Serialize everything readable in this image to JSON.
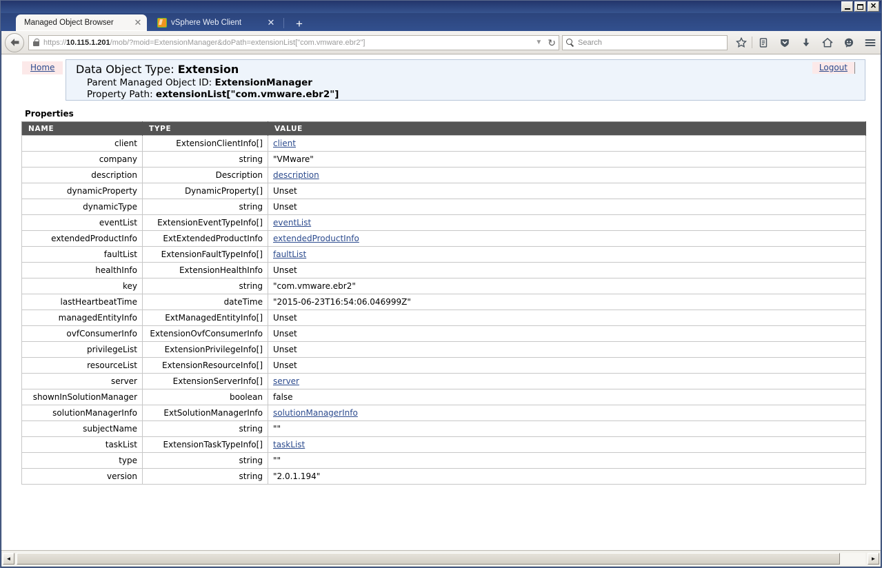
{
  "window": {
    "minimize_label": "Minimize",
    "maximize_label": "Maximize",
    "close_label": "Close"
  },
  "browser": {
    "tabs": [
      {
        "title": "Managed Object Browser",
        "active": true,
        "favicon": "none",
        "close_glyph": "✕"
      },
      {
        "title": "vSphere Web Client",
        "active": false,
        "favicon": "vsphere-plugin-icon",
        "close_glyph": "✕"
      }
    ],
    "new_tab_glyph": "+",
    "back_glyph": "←",
    "url": {
      "scheme": "https://",
      "host": "10.115.1.201",
      "path": "/mob/?moid=ExtensionManager&doPath=extensionList[\"com.vmware.ebr2\"]",
      "full": "https://10.115.1.201/mob/?moid=ExtensionManager&doPath=extensionList[\"com.vmware.ebr2\"]",
      "dropdown_glyph": "▼",
      "reload_glyph": "↻"
    },
    "search": {
      "placeholder": "Search",
      "value": ""
    },
    "toolbar_icons": [
      "bookmark-star-icon",
      "reader-list-icon",
      "pocket-shield-icon",
      "downloads-arrow-icon",
      "home-icon",
      "feedback-smiley-icon",
      "hamburger-menu-icon"
    ]
  },
  "page": {
    "home_link": "Home",
    "logout_link": "Logout",
    "title_prefix": "Data Object Type:",
    "title_value": "Extension",
    "parent_label": "Parent Managed Object ID:",
    "parent_value": "ExtensionManager",
    "path_label": "Property Path:",
    "path_value": "extensionList[\"com.vmware.ebr2\"]",
    "properties_heading": "Properties",
    "table": {
      "columns": [
        "NAME",
        "TYPE",
        "VALUE"
      ],
      "rows": [
        {
          "name": "client",
          "type": "ExtensionClientInfo[]",
          "value": "client",
          "is_link": true
        },
        {
          "name": "company",
          "type": "string",
          "value": "\"VMware\"",
          "is_link": false
        },
        {
          "name": "description",
          "type": "Description",
          "value": "description",
          "is_link": true
        },
        {
          "name": "dynamicProperty",
          "type": "DynamicProperty[]",
          "value": "Unset",
          "is_link": false
        },
        {
          "name": "dynamicType",
          "type": "string",
          "value": "Unset",
          "is_link": false
        },
        {
          "name": "eventList",
          "type": "ExtensionEventTypeInfo[]",
          "value": "eventList",
          "is_link": true
        },
        {
          "name": "extendedProductInfo",
          "type": "ExtExtendedProductInfo",
          "value": "extendedProductInfo",
          "is_link": true
        },
        {
          "name": "faultList",
          "type": "ExtensionFaultTypeInfo[]",
          "value": "faultList",
          "is_link": true
        },
        {
          "name": "healthInfo",
          "type": "ExtensionHealthInfo",
          "value": "Unset",
          "is_link": false
        },
        {
          "name": "key",
          "type": "string",
          "value": "\"com.vmware.ebr2\"",
          "is_link": false
        },
        {
          "name": "lastHeartbeatTime",
          "type": "dateTime",
          "value": "\"2015-06-23T16:54:06.046999Z\"",
          "is_link": false
        },
        {
          "name": "managedEntityInfo",
          "type": "ExtManagedEntityInfo[]",
          "value": "Unset",
          "is_link": false
        },
        {
          "name": "ovfConsumerInfo",
          "type": "ExtensionOvfConsumerInfo",
          "value": "Unset",
          "is_link": false
        },
        {
          "name": "privilegeList",
          "type": "ExtensionPrivilegeInfo[]",
          "value": "Unset",
          "is_link": false
        },
        {
          "name": "resourceList",
          "type": "ExtensionResourceInfo[]",
          "value": "Unset",
          "is_link": false
        },
        {
          "name": "server",
          "type": "ExtensionServerInfo[]",
          "value": "server",
          "is_link": true
        },
        {
          "name": "shownInSolutionManager",
          "type": "boolean",
          "value": "false",
          "is_link": false
        },
        {
          "name": "solutionManagerInfo",
          "type": "ExtSolutionManagerInfo",
          "value": "solutionManagerInfo",
          "is_link": true
        },
        {
          "name": "subjectName",
          "type": "string",
          "value": "\"\"",
          "is_link": false
        },
        {
          "name": "taskList",
          "type": "ExtensionTaskTypeInfo[]",
          "value": "taskList",
          "is_link": true
        },
        {
          "name": "type",
          "type": "string",
          "value": "\"\"",
          "is_link": false
        },
        {
          "name": "version",
          "type": "string",
          "value": "\"2.0.1.194\"",
          "is_link": false
        }
      ]
    }
  },
  "scrollbar": {
    "left_arrow": "◄",
    "right_arrow": "►"
  },
  "colors": {
    "titlebar": "#2a4179",
    "table_header_bg": "#545454",
    "link": "#2c4b8e",
    "home_tab_bg": "#fce9e9",
    "header_box_bg": "#eef4fb"
  }
}
